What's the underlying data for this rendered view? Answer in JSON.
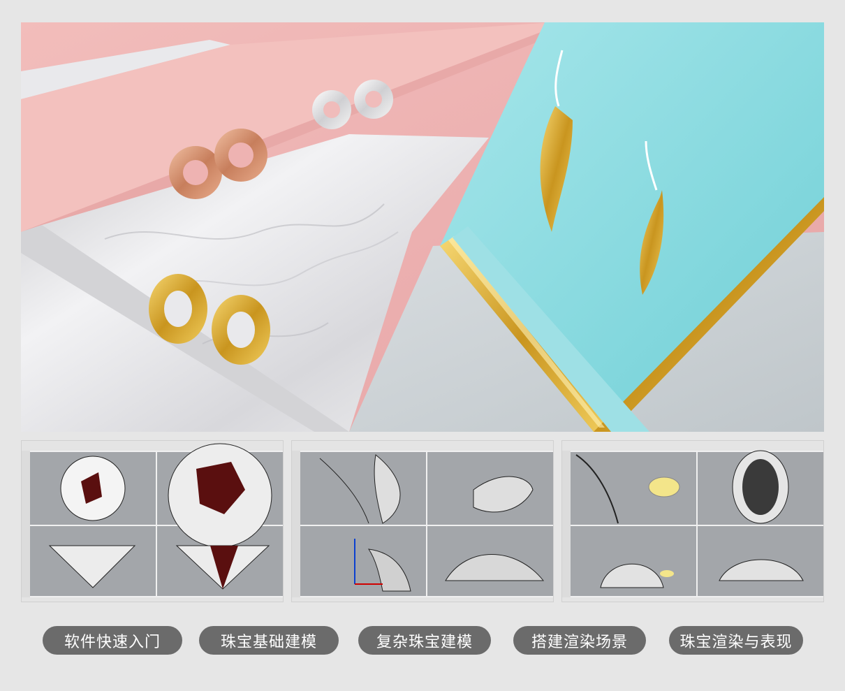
{
  "hero": {
    "image": "jewelry-earrings-render",
    "colors": {
      "pink": "#eeb3b2",
      "marble": "#e4e4e6",
      "teal": "#8fdde1",
      "gold": "#d6a934",
      "rose_gold": "#d99a79",
      "silver": "#eceaea"
    }
  },
  "screenshots": [
    {
      "image": "rhino-diamond-modeling-viewports"
    },
    {
      "image": "rhino-petal-ring-modeling-viewports"
    },
    {
      "image": "rhino-pave-dome-modeling-viewports"
    }
  ],
  "tags": [
    {
      "label": "软件快速入门"
    },
    {
      "label": "珠宝基础建模"
    },
    {
      "label": "复杂珠宝建模"
    },
    {
      "label": "搭建渲染场景"
    },
    {
      "label": "珠宝渲染与表现"
    }
  ]
}
